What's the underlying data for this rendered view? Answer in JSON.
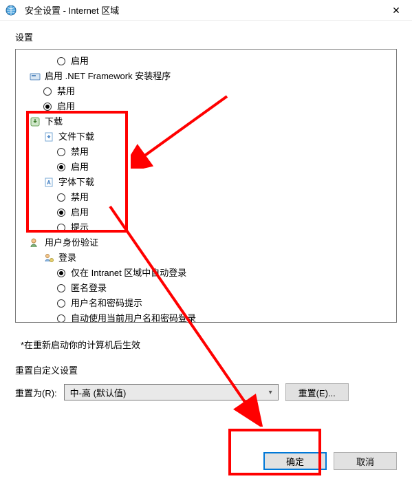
{
  "title": "安全设置 - Internet 区域",
  "settingsLabel": "设置",
  "tree": {
    "enable0": "启用",
    "netfx": "启用 .NET Framework 安装程序",
    "netfx_disable": "禁用",
    "netfx_enable": "启用",
    "download": "下载",
    "file_download": "文件下载",
    "file_disable": "禁用",
    "file_enable": "启用",
    "font_download": "字体下载",
    "font_disable": "禁用",
    "font_enable": "启用",
    "font_prompt": "提示",
    "auth": "用户身份验证",
    "login": "登录",
    "intranet_only": "仅在 Intranet 区域中自动登录",
    "anon": "匿名登录",
    "userpass_prompt": "用户名和密码提示",
    "auto_current": "自动使用当前用户名和密码登录"
  },
  "note": "*在重新启动你的计算机后生效",
  "reset": {
    "sectionTitle": "重置自定义设置",
    "label": "重置为(R):",
    "comboValue": "中-高 (默认值)",
    "resetBtn": "重置(E)..."
  },
  "okBtn": "确定",
  "cancelBtn": "取消"
}
